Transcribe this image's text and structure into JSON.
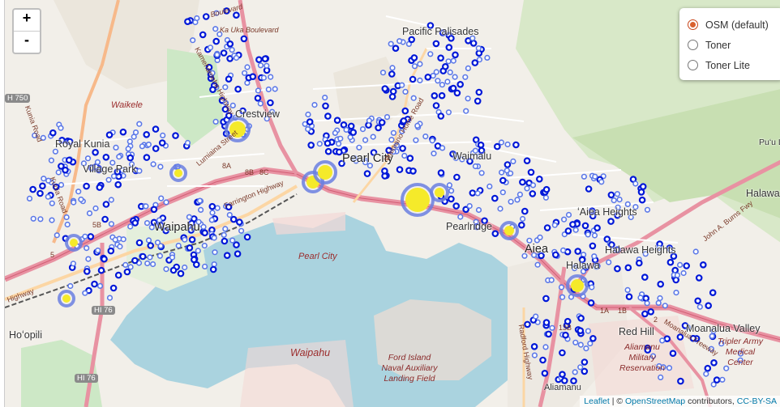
{
  "zoom": {
    "in_label": "+",
    "out_label": "-"
  },
  "layers": {
    "options": [
      {
        "label": "OSM (default)",
        "checked": true
      },
      {
        "label": "Toner",
        "checked": false
      },
      {
        "label": "Toner Lite",
        "checked": false
      }
    ]
  },
  "attribution": {
    "leaflet": "Leaflet",
    "separator": " | © ",
    "osm": "OpenStreetMap",
    "contributors": " contributors, ",
    "license": "CC-BY-SA"
  },
  "map_labels": {
    "places": {
      "pacific_palisades": "Pacific Palisades",
      "crestview": "Crestview",
      "royal_kunia": "Royal Kunia",
      "village_park": "Village Park",
      "waipahu": "Waipahu",
      "pearl_city": "Pearl City",
      "waimalu": "Waimalu",
      "pearlridge": "Pearlridge",
      "aiea": "Aiea",
      "halawa": "Halawa",
      "aiea_heights": "ʻAiea Heights",
      "halawa_heights": "Halawa Heights",
      "red_hill": "Red Hill",
      "moanalua_valley": "Moanalua Valley",
      "hoopili": "Hoʻopili",
      "halawa_edge": "Halawa",
      "puu_lo": "Puʻu Lo"
    },
    "water": {
      "waikele": "Waikele",
      "pearl_city_water": "Pearl City",
      "waipahu_water": "Waipahu"
    },
    "military": {
      "ford_island": "Ford Island Naval Auxiliary Landing Field",
      "aliamanu": "Aliamanu Military Reservation",
      "tripler": "Tripler Army Medical Center",
      "aliamanu_edge": "Aliamanu"
    },
    "roads": {
      "ka_uka": "Ka Uka Boulevard",
      "boulevard": "Boulevard",
      "kamehameha": "Kamehameha Highway",
      "lumiaina": "Lumiaina Street",
      "farrington": "Farrington Highway",
      "waimano": "Waimano Home Road",
      "kunia": "Kunia Road",
      "kunia2": "Kunia Road",
      "burns": "John A. Burns Fwy",
      "moanalua_fwy": "Moanalua Freeway",
      "radford": "Radford Highway",
      "hwy": "Highway"
    },
    "shields": {
      "h750": "H 750",
      "h176a": "HI 76",
      "h176b": "HI 76",
      "r8a": "8A",
      "r8b": "8B",
      "r8c": "8C",
      "r5b": "5B",
      "r1a": "1A",
      "r1b": "1B",
      "r2": "2",
      "r13b": "13B",
      "r5": "5"
    }
  }
}
